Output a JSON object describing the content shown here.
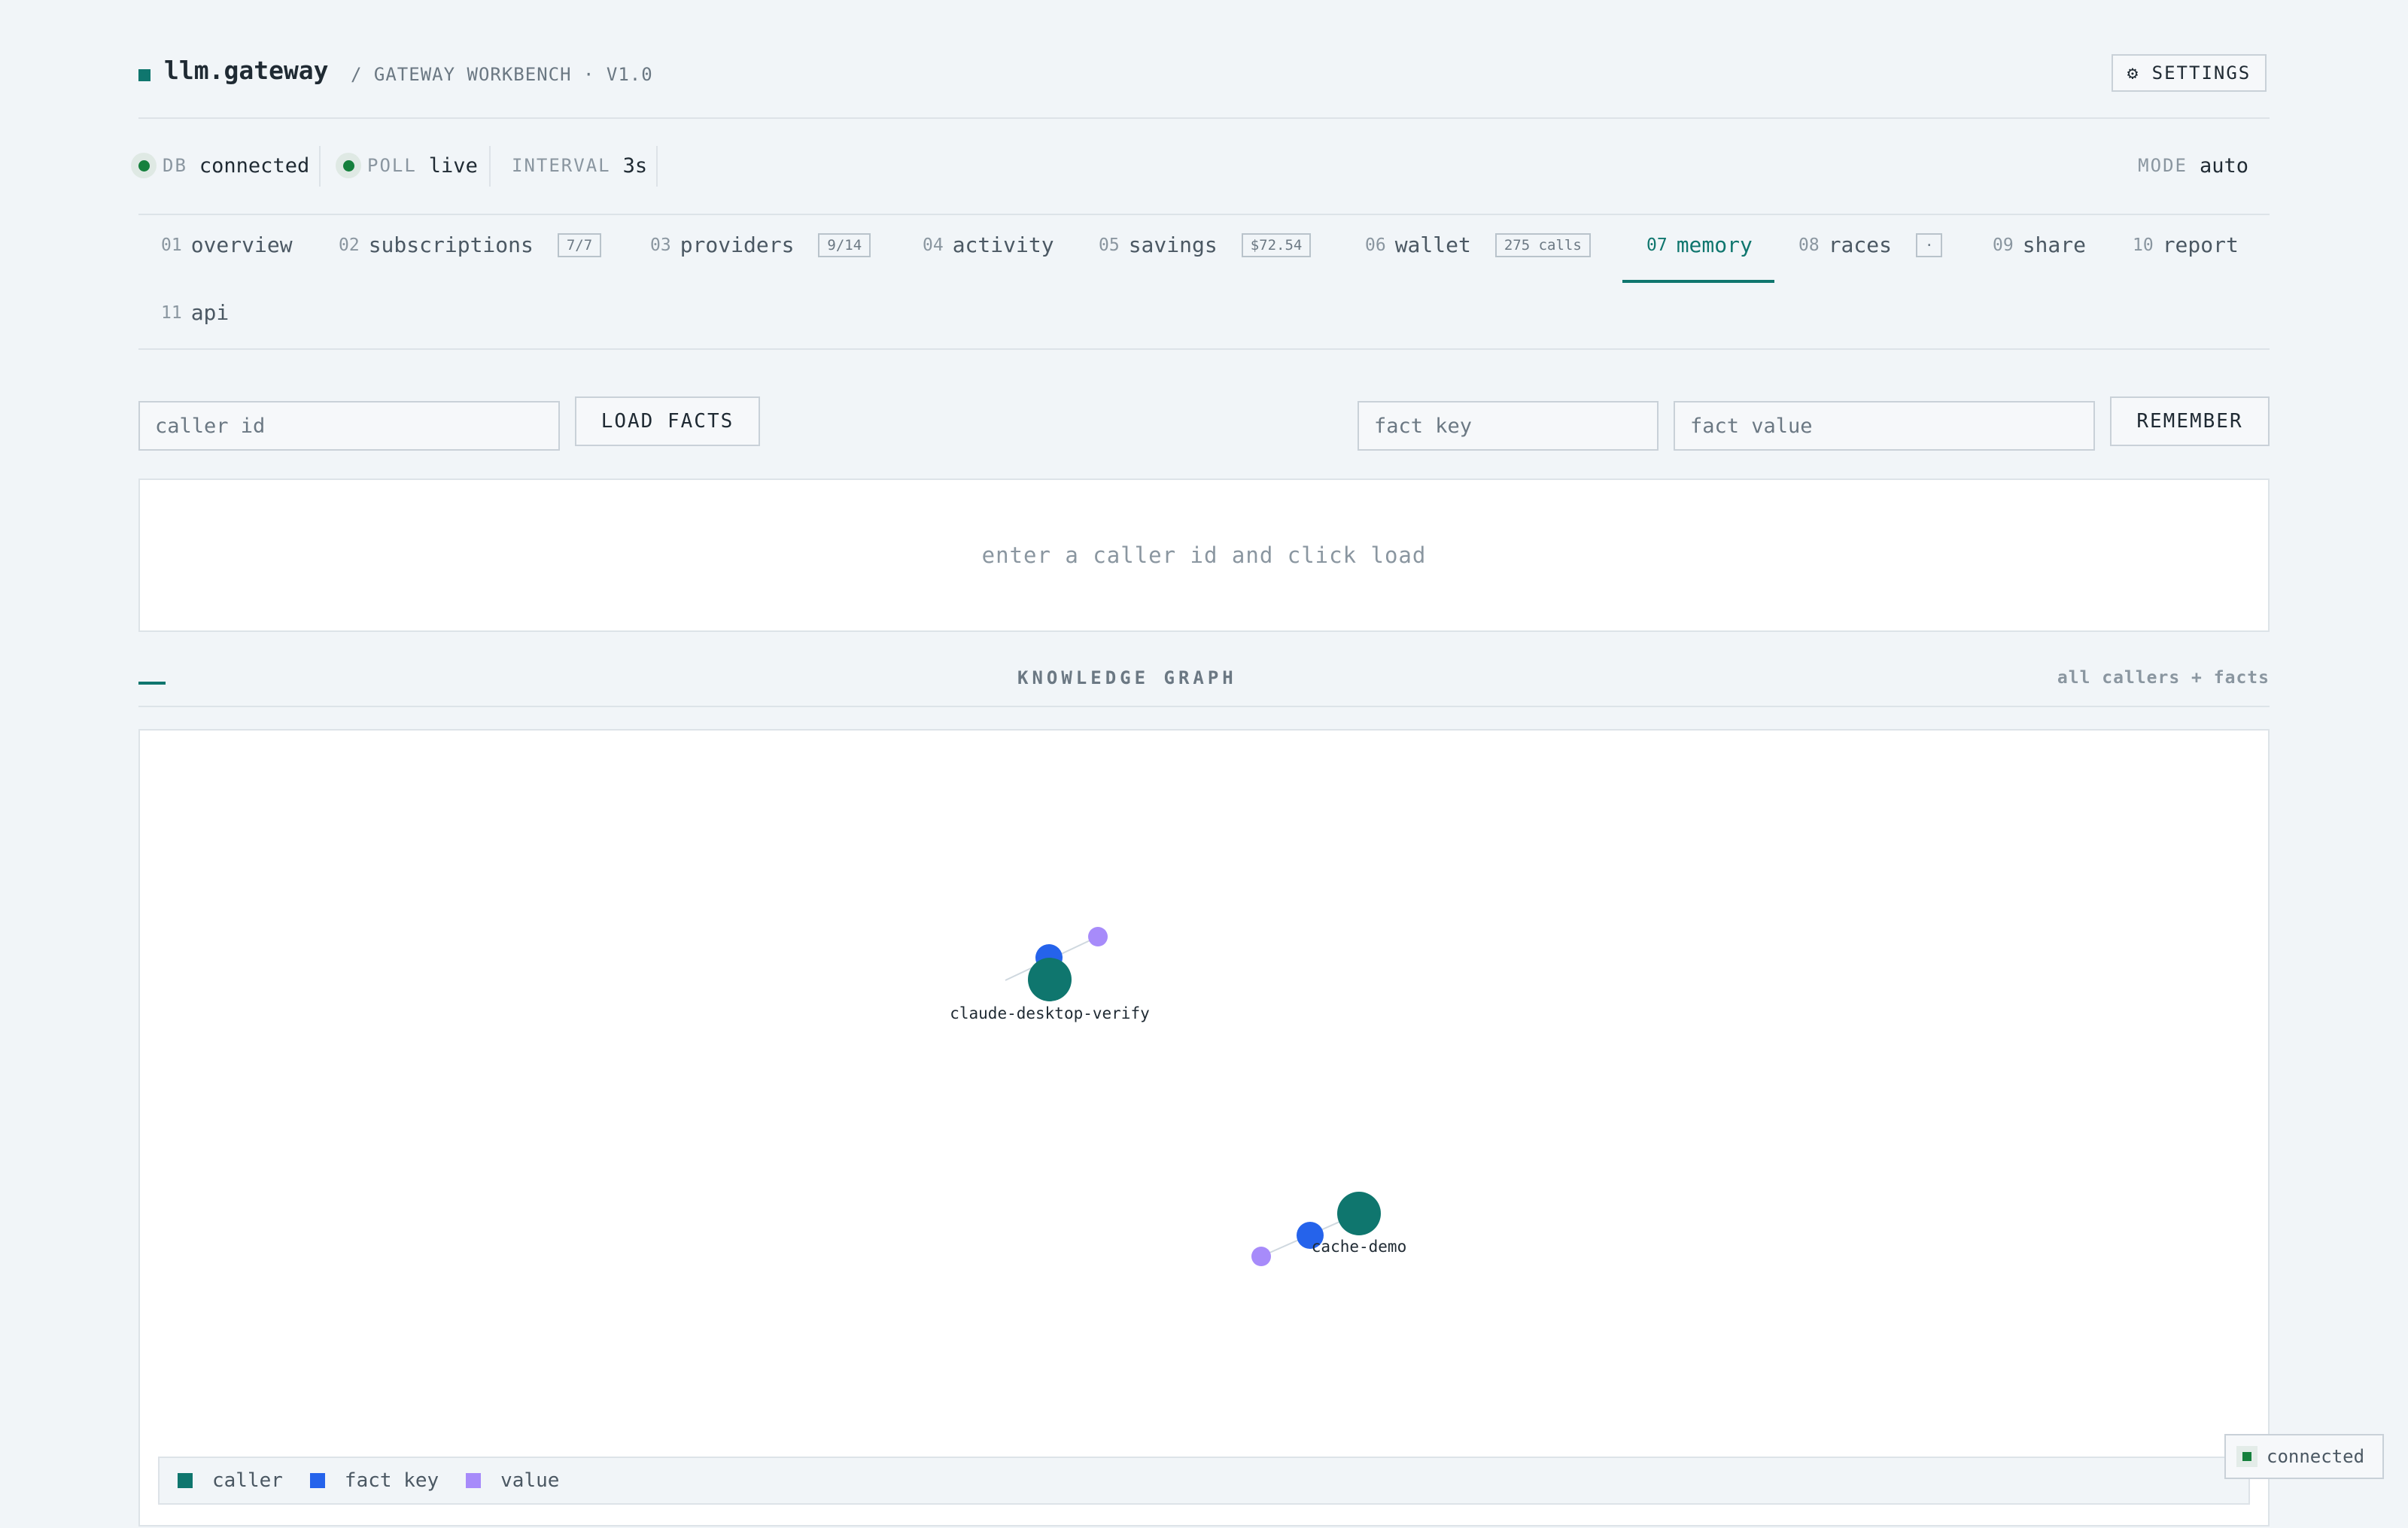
{
  "header": {
    "brand": "llm.gateway",
    "subtitle": "/ GATEWAY WORKBENCH · V1.0",
    "settings_icon": "gear-icon",
    "settings_label": "⚙ SETTINGS"
  },
  "status": {
    "db_label": "DB",
    "db_value": "connected",
    "poll_label": "POLL",
    "poll_value": "live",
    "interval_label": "INTERVAL",
    "interval_value": "3s",
    "mode_label": "MODE",
    "mode_value": "auto",
    "ok_color": "#15803d"
  },
  "tabs": [
    {
      "num": "01",
      "label": "overview"
    },
    {
      "num": "02",
      "label": "subscriptions",
      "badge": "7/7"
    },
    {
      "num": "03",
      "label": "providers",
      "badge": "9/14"
    },
    {
      "num": "04",
      "label": "activity"
    },
    {
      "num": "05",
      "label": "savings",
      "badge": "$72.54"
    },
    {
      "num": "06",
      "label": "wallet",
      "badge": "275 calls"
    },
    {
      "num": "07",
      "label": "memory",
      "active": true
    },
    {
      "num": "08",
      "label": "races",
      "badge": "·"
    },
    {
      "num": "09",
      "label": "share"
    },
    {
      "num": "10",
      "label": "report"
    },
    {
      "num": "11",
      "label": "api"
    }
  ],
  "memory": {
    "caller_placeholder": "caller id",
    "load_label": "LOAD FACTS",
    "fact_key_placeholder": "fact key",
    "fact_value_placeholder": "fact value",
    "remember_label": "REMEMBER",
    "empty_message": "enter a caller id and click load"
  },
  "graph": {
    "title": "KNOWLEDGE GRAPH",
    "scope": "all callers + facts",
    "colors": {
      "caller": "#0f766e",
      "fact_key": "#2563eb",
      "value": "#a78bfa",
      "edge": "#cfd8df"
    },
    "callers": [
      "claude-desktop-verify",
      "cache-demo"
    ],
    "legend": [
      {
        "label": "caller",
        "color": "#0f766e"
      },
      {
        "label": "fact key",
        "color": "#2563eb"
      },
      {
        "label": "value",
        "color": "#a78bfa"
      }
    ]
  },
  "toast": {
    "label": "connected"
  },
  "accent": "#0f766e"
}
